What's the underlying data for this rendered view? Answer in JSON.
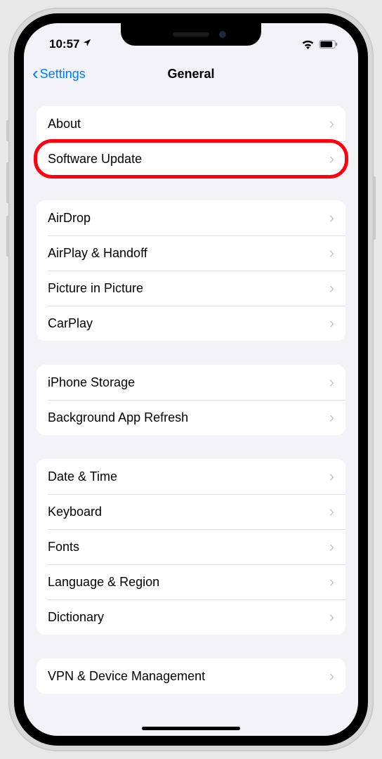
{
  "status": {
    "time": "10:57",
    "locationIcon": "location-arrow"
  },
  "nav": {
    "back": "Settings",
    "title": "General"
  },
  "groups": [
    {
      "rows": [
        {
          "label": "About",
          "id": "about"
        },
        {
          "label": "Software Update",
          "id": "software-update",
          "highlighted": true
        }
      ]
    },
    {
      "rows": [
        {
          "label": "AirDrop",
          "id": "airdrop"
        },
        {
          "label": "AirPlay & Handoff",
          "id": "airplay-handoff"
        },
        {
          "label": "Picture in Picture",
          "id": "picture-in-picture"
        },
        {
          "label": "CarPlay",
          "id": "carplay"
        }
      ]
    },
    {
      "rows": [
        {
          "label": "iPhone Storage",
          "id": "iphone-storage"
        },
        {
          "label": "Background App Refresh",
          "id": "background-app-refresh"
        }
      ]
    },
    {
      "rows": [
        {
          "label": "Date & Time",
          "id": "date-time"
        },
        {
          "label": "Keyboard",
          "id": "keyboard"
        },
        {
          "label": "Fonts",
          "id": "fonts"
        },
        {
          "label": "Language & Region",
          "id": "language-region"
        },
        {
          "label": "Dictionary",
          "id": "dictionary"
        }
      ]
    },
    {
      "rows": [
        {
          "label": "VPN & Device Management",
          "id": "vpn-device-management"
        }
      ]
    }
  ],
  "highlightColor": "#ff0011"
}
